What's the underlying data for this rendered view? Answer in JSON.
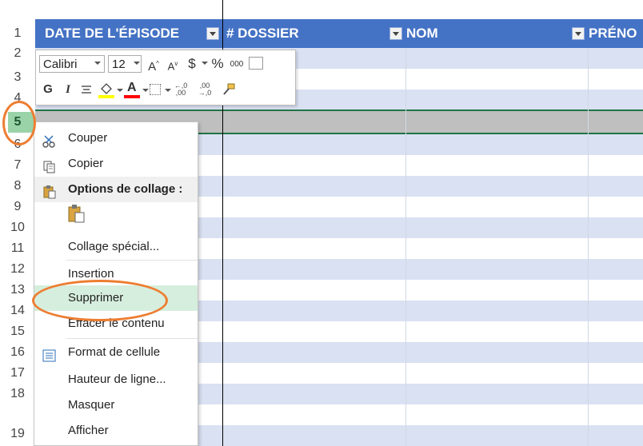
{
  "header": {
    "row_number": "1",
    "columns": [
      {
        "label": "DATE DE L'ÉPISODE"
      },
      {
        "label": "# DOSSIER"
      },
      {
        "label": "NOM"
      },
      {
        "label": "PRÉNO"
      }
    ]
  },
  "row_numbers": [
    "2",
    "3",
    "4",
    "5",
    "6",
    "7",
    "8",
    "9",
    "10",
    "11",
    "12",
    "13",
    "14",
    "15",
    "16",
    "17",
    "18",
    "19"
  ],
  "selected_row": "5",
  "mini_toolbar": {
    "font_name": "Calibri",
    "font_size": "12",
    "grow_font": "A",
    "shrink_font": "A",
    "currency": "$",
    "percent": "%",
    "thousands": "000",
    "bold": "G",
    "italic": "I",
    "font_color_letter": "A",
    "increase_decimal": "←,0 ,00",
    "decrease_decimal": ",00 →,0"
  },
  "context_menu": {
    "items": [
      {
        "label": "Couper",
        "icon": "scissors-icon"
      },
      {
        "label": "Copier",
        "icon": "copy-icon"
      },
      {
        "label": "Options de collage :",
        "icon": "paste-options-icon"
      },
      {
        "label": "Collage spécial..."
      },
      {
        "label": "Insertion"
      },
      {
        "label": "Supprimer"
      },
      {
        "label": "Effacer le contenu"
      },
      {
        "label": "Format de cellule",
        "icon": "format-cells-icon"
      },
      {
        "label": "Hauteur de ligne..."
      },
      {
        "label": "Masquer"
      },
      {
        "label": "Afficher"
      }
    ]
  },
  "colors": {
    "header_blue": "#4472C4",
    "band_blue": "#D9E1F2",
    "selection_gray": "#BFBFBF",
    "hover_green": "#D6EEDD",
    "annotation_orange": "#ED7D31",
    "excel_green": "#217346"
  }
}
